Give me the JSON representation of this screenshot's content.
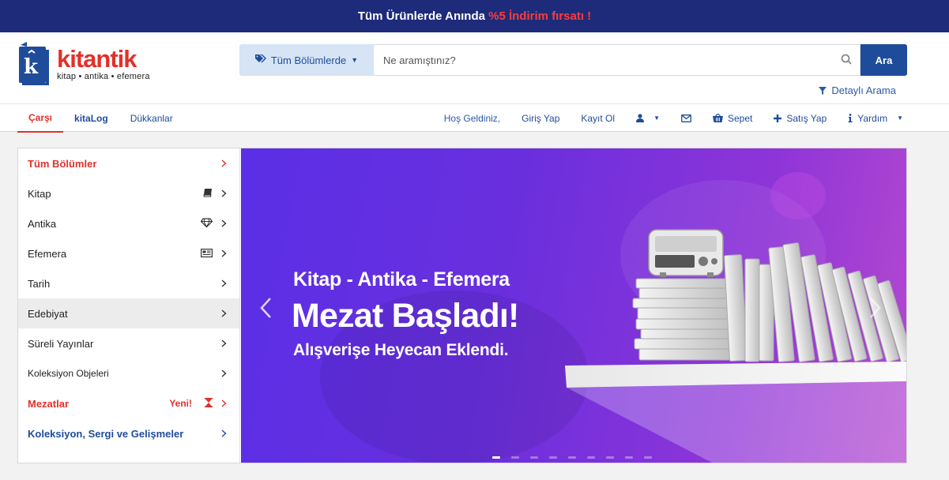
{
  "promo": {
    "text_before": "Tüm Ürünlerde Anında ",
    "highlight": "%5 İndirim fırsatı !"
  },
  "logo": {
    "name": "kitantik",
    "tagline": "kitap • antika • efemera"
  },
  "search": {
    "category_label": "Tüm Bölümlerde",
    "placeholder": "Ne aramıştınız?",
    "button_label": "Ara",
    "advanced_label": "Detaylı Arama"
  },
  "nav": {
    "left": [
      {
        "label": "Çarşı",
        "active": true
      },
      {
        "label": "kitaLog"
      },
      {
        "label": "Dükkanlar"
      }
    ],
    "welcome": "Hoş Geldiniz,",
    "login": "Giriş Yap",
    "register": "Kayıt Ol",
    "cart": "Sepet",
    "sell": "Satış Yap",
    "help": "Yardım"
  },
  "sidebar": {
    "items": [
      {
        "label": "Tüm Bölümler"
      },
      {
        "label": "Kitap",
        "icon": "book-icon"
      },
      {
        "label": "Antika",
        "icon": "diamond-icon"
      },
      {
        "label": "Efemera",
        "icon": "newspaper-icon"
      },
      {
        "label": "Tarih"
      },
      {
        "label": "Edebiyat"
      },
      {
        "label": "Süreli Yayınlar"
      },
      {
        "label": "Koleksiyon Objeleri"
      },
      {
        "label": "Mezatlar",
        "badge": "Yeni!",
        "icon": "hourglass-icon"
      },
      {
        "label": "Koleksiyon, Sergi ve Gelişmeler"
      }
    ]
  },
  "banner": {
    "line1": "Kitap - Antika - Efemera",
    "line2": "Mezat Başladı!",
    "line3": "Alışverişe Heyecan Eklendi.",
    "slide_count": 9,
    "active_slide": 1
  },
  "colors": {
    "brand_red": "#e1312a",
    "brand_blue": "#1e4c9a",
    "promo_bg": "#1d2b7a"
  }
}
